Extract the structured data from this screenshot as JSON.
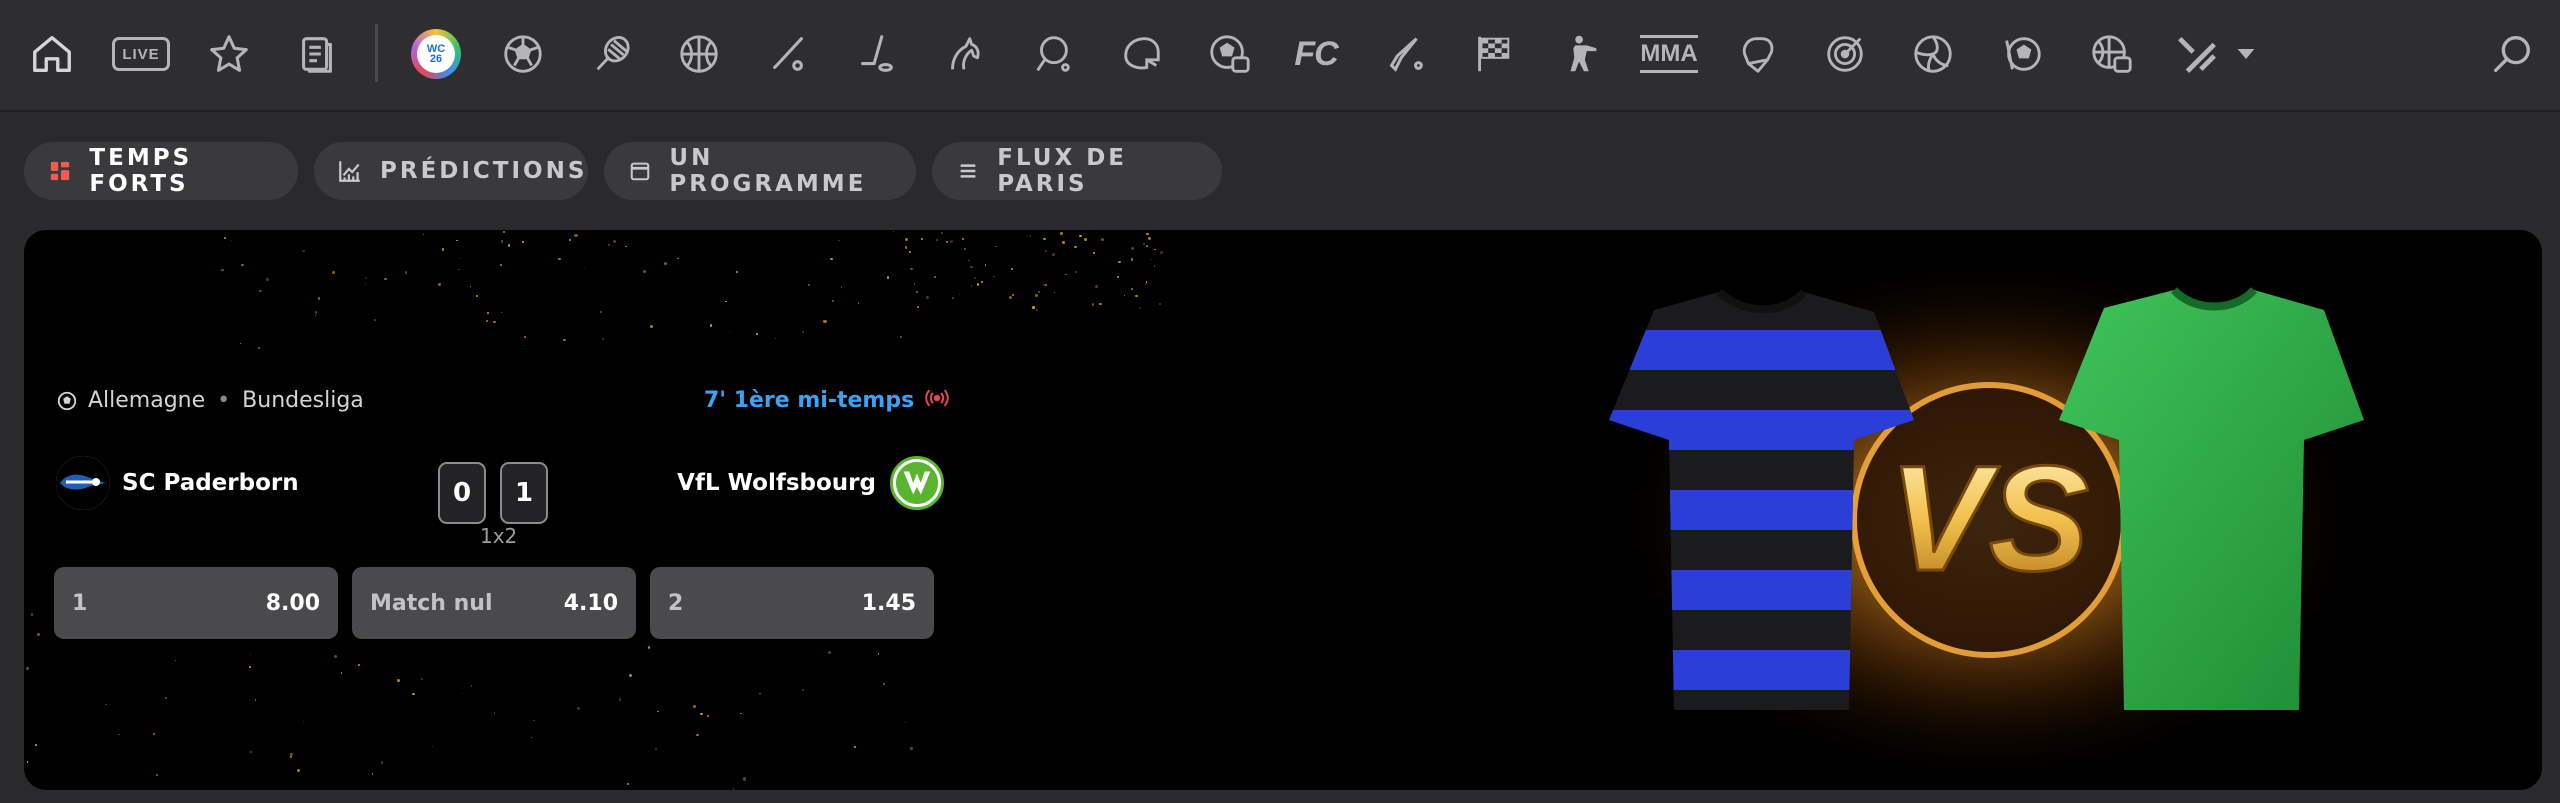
{
  "nav": {
    "live_label": "LIVE",
    "fc_label": "FC",
    "mma_label": "MMA",
    "wc_label": "WC\n26"
  },
  "tabs": [
    {
      "label": "TEMPS FORTS",
      "active": true,
      "icon": "grid-icon"
    },
    {
      "label": "PRÉDICTIONS",
      "active": false,
      "icon": "chart-icon"
    },
    {
      "label": "UN PROGRAMME",
      "active": false,
      "icon": "calendar-icon"
    },
    {
      "label": "FLUX DE PARIS",
      "active": false,
      "icon": "list-icon"
    }
  ],
  "match": {
    "country": "Allemagne",
    "league": "Bundesliga",
    "status": "7' 1ère mi-temps",
    "home": {
      "name": "SC Paderborn",
      "score": "0"
    },
    "away": {
      "name": "VfL Wolfsbourg",
      "score": "1"
    },
    "market": "1x2",
    "odds": [
      {
        "label": "1",
        "value": "8.00"
      },
      {
        "label": "Match nul",
        "value": "4.10"
      },
      {
        "label": "2",
        "value": "1.45"
      }
    ]
  },
  "art": {
    "vs_text": "VS"
  },
  "colors": {
    "accent_live": "#3ba3f5",
    "live_red": "#e5484d",
    "active_tab_icon": "#f05a4f"
  }
}
